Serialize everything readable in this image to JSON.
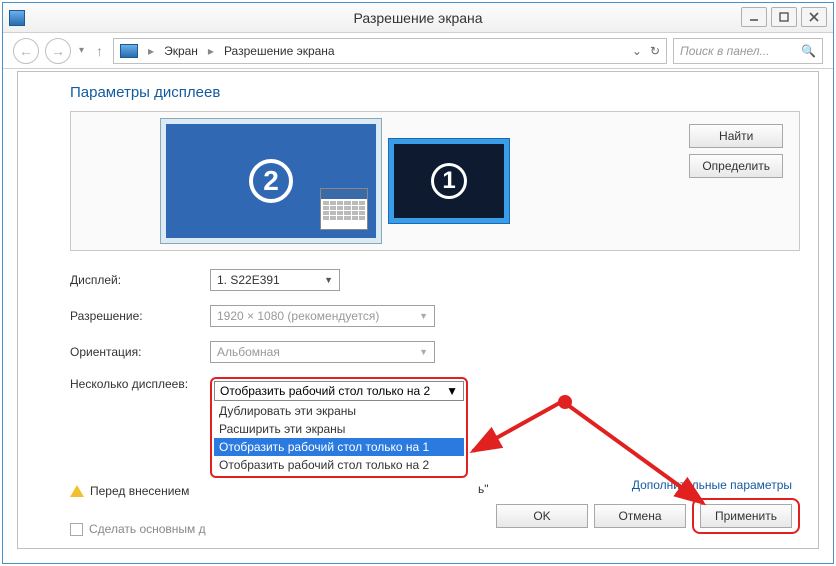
{
  "window": {
    "title": "Разрешение экрана"
  },
  "toolbar": {
    "crumb1": "Экран",
    "crumb2": "Разрешение экрана",
    "search_placeholder": "Поиск в панел..."
  },
  "section": {
    "title": "Параметры дисплеев"
  },
  "preview": {
    "display1_num": "1",
    "display2_num": "2",
    "find_btn": "Найти",
    "identify_btn": "Определить"
  },
  "fields": {
    "display_label": "Дисплей:",
    "display_value": "1. S22E391",
    "resolution_label": "Разрешение:",
    "resolution_value": "1920 × 1080 (рекомендуется)",
    "orientation_label": "Ориентация:",
    "orientation_value": "Альбомная",
    "multi_label": "Несколько дисплеев:",
    "multi_selected": "Отобразить рабочий стол только на 2",
    "multi_options": [
      "Дублировать эти экраны",
      "Расширить эти экраны",
      "Отобразить рабочий стол только на 1",
      "Отобразить рабочий стол только на 2"
    ],
    "warn_text": "Перед внесением",
    "warn_tail": "ь\"",
    "make_primary": "Сделать основным д"
  },
  "links": {
    "advanced": "Дополнительные параметры"
  },
  "buttons": {
    "ok": "OK",
    "cancel": "Отмена",
    "apply": "Применить"
  }
}
